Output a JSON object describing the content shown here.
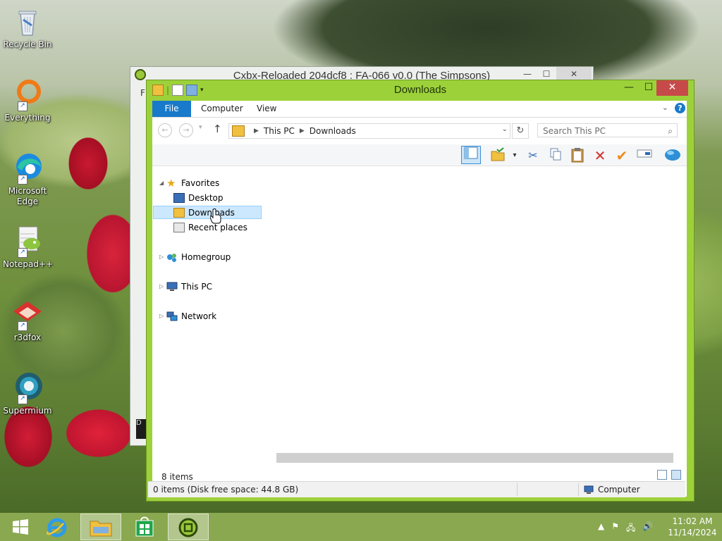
{
  "desktop": {
    "icons": [
      {
        "label": "Recycle Bin"
      },
      {
        "label": "Everything"
      },
      {
        "label": "Microsoft Edge"
      },
      {
        "label": "Notepad++"
      },
      {
        "label": "r3dfox"
      },
      {
        "label": "Supermium"
      }
    ]
  },
  "background_window": {
    "title": "Cxbx-Reloaded 204dcf8 : FA-066 v0.0 (The Simpsons)",
    "menu_stub": "F",
    "dark_stub": "D"
  },
  "explorer": {
    "title": "Downloads",
    "controls": {
      "minimize": "—",
      "maximize": "☐",
      "close": "✕"
    },
    "ribbon_tabs": [
      "File",
      "Computer",
      "View"
    ],
    "address": {
      "segments": [
        "This PC",
        "Downloads"
      ]
    },
    "search_placeholder": "Search This PC",
    "nav": {
      "favorites": "Favorites",
      "favorites_items": [
        "Desktop",
        "Downloads",
        "Recent places"
      ],
      "homegroup": "Homegroup",
      "this_pc": "This PC",
      "network": "Network"
    },
    "item_count": "8 items",
    "status": {
      "left": "0 items (Disk free space: 44.8 GB)",
      "right": "Computer"
    }
  },
  "taskbar": {
    "clock_time": "11:02 AM",
    "clock_date": "11/14/2024"
  },
  "colors": {
    "window_frame": "#9dd13a",
    "file_tab": "#1979ca",
    "close_button": "#c74a4a",
    "selection": "#cce8ff"
  }
}
